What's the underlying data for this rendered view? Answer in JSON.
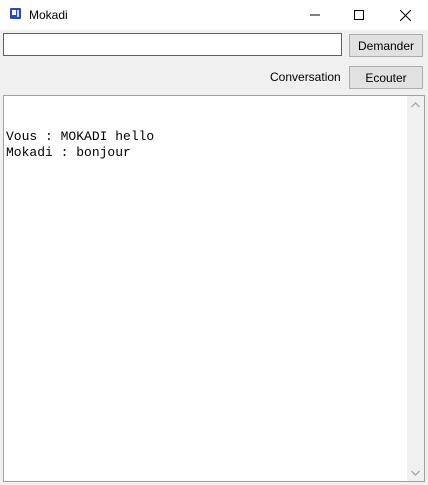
{
  "window": {
    "title": "Mokadi",
    "app_icon": "app-icon",
    "controls": {
      "minimize_icon": "minimize-icon",
      "maximize_icon": "maximize-icon",
      "close_icon": "close-icon"
    }
  },
  "ask_input": {
    "value": "",
    "placeholder": ""
  },
  "buttons": {
    "ask_label": "Demander",
    "listen_label": "Ecouter"
  },
  "conversation": {
    "label": "Conversation",
    "lines": [
      "Vous : MOKADI hello",
      "Mokadi : bonjour"
    ]
  },
  "colors": {
    "input_focus_border": "#0078d7",
    "button_face": "#e1e1e1",
    "window_bg": "#f0f0f0",
    "app_icon": "#2b4bb8"
  }
}
